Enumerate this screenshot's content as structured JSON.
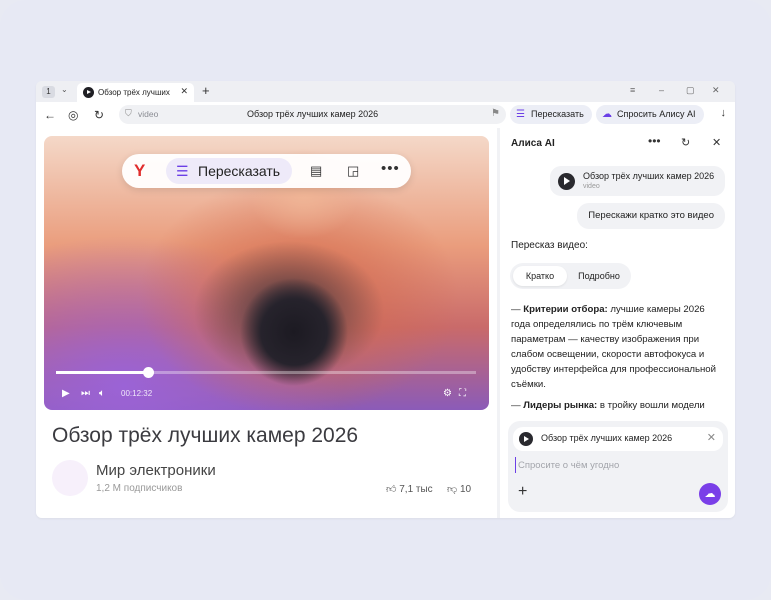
{
  "browser": {
    "tab_count": "1",
    "tab_title": "Обзор трёх лучших",
    "url_host": "video",
    "url_page_title": "Обзор трёх лучших камер 2026",
    "retell_button": "Пересказать",
    "ask_alice_button": "Спросить Алису AI"
  },
  "video": {
    "overlay_retell": "Пересказать",
    "time": "00:12:32",
    "progress_fraction": 0.22,
    "title": "Обзор трёх лучших камер 2026",
    "channel": "Мир электроники",
    "subscribers": "1,2 М подписчиков",
    "likes": "7,1 тыс",
    "dislikes": "10"
  },
  "assistant": {
    "title": "Алиса AI",
    "video_chip_title": "Обзор трёх лучших камер 2026",
    "video_chip_source": "video",
    "user_message": "Перескажи кратко это видео",
    "answer_heading": "Пересказ видео:",
    "seg_short": "Кратко",
    "seg_detailed": "Подробно",
    "point1_prefix": "— ",
    "point1_bold": "Критерии отбора:",
    "point1_text": " лучшие камеры 2026 года определялись по трём ключевым параметрам — качеству изображения при слабом освещении, скорости автофокуса и удобству интерфейса для профессиональной съёмки.",
    "point2_prefix": "— ",
    "point2_bold": "Лидеры рынка:",
    "point2_text": " в тройку вошли модели",
    "context_chip": "Обзор трёх лучших камер 2026",
    "input_placeholder": "Спросите о чём угодно"
  },
  "colors": {
    "accent": "#6b3fe6",
    "send_button": "#7a3fe8"
  }
}
